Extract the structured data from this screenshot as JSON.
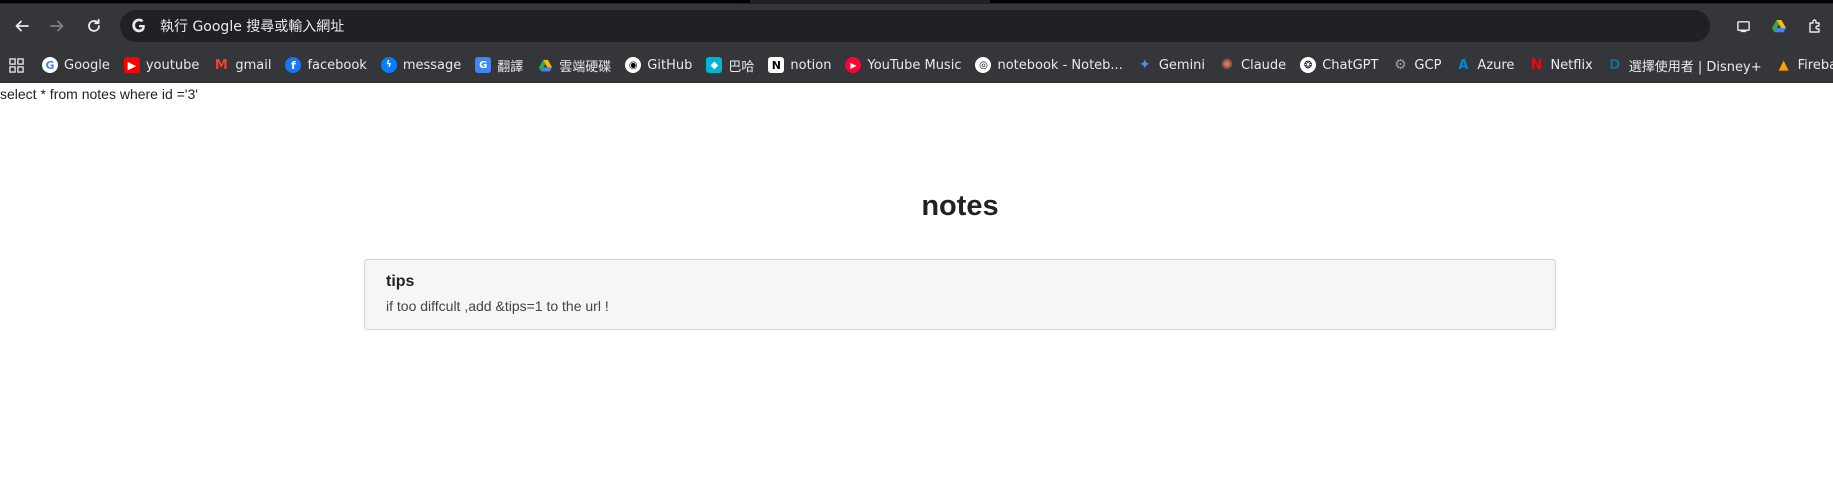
{
  "browser": {
    "address_bar": {
      "placeholder_text": "執行 Google 搜尋或輸入網址"
    },
    "bookmarks": [
      {
        "label": "Google",
        "icon": "google-icon",
        "color": "#4285f4"
      },
      {
        "label": "youtube",
        "icon": "youtube-icon",
        "color": "#ff0000"
      },
      {
        "label": "gmail",
        "icon": "gmail-icon",
        "color": "#ea4335"
      },
      {
        "label": "facebook",
        "icon": "facebook-icon",
        "color": "#1877f2"
      },
      {
        "label": "message",
        "icon": "messenger-icon",
        "color": "#0a7cff"
      },
      {
        "label": "翻譯",
        "icon": "translate-icon",
        "color": "#4285f4"
      },
      {
        "label": "雲端硬碟",
        "icon": "drive-icon",
        "color": "#34a853"
      },
      {
        "label": "GitHub",
        "icon": "github-icon",
        "color": "#ffffff"
      },
      {
        "label": "巴哈",
        "icon": "bahamut-icon",
        "color": "#00b4d8"
      },
      {
        "label": "notion",
        "icon": "notion-icon",
        "color": "#ffffff"
      },
      {
        "label": "YouTube Music",
        "icon": "youtube-music-icon",
        "color": "#ff0033"
      },
      {
        "label": "notebook - Noteb...",
        "icon": "notebooklm-icon",
        "color": "#ffffff"
      },
      {
        "label": "Gemini",
        "icon": "gemini-icon",
        "color": "#4f8df5"
      },
      {
        "label": "Claude",
        "icon": "claude-icon",
        "color": "#d97757"
      },
      {
        "label": "ChatGPT",
        "icon": "chatgpt-icon",
        "color": "#ffffff"
      },
      {
        "label": "GCP",
        "icon": "gcp-icon",
        "color": "#9aa0a6"
      },
      {
        "label": "Azure",
        "icon": "azure-icon",
        "color": "#0089d6"
      },
      {
        "label": "Netflix",
        "icon": "netflix-icon",
        "color": "#e50914"
      },
      {
        "label": "選擇使用者 | Disney+",
        "icon": "disney-plus-icon",
        "color": "#1c6b8a"
      },
      {
        "label": "Firebase",
        "icon": "firebase-icon",
        "color": "#ffa000"
      }
    ]
  },
  "page": {
    "query_text": "select * from notes where id ='3'",
    "title": "notes",
    "notes": [
      {
        "title": "tips",
        "body": "if too diffcult ,add &tips=1 to the url !"
      }
    ]
  }
}
